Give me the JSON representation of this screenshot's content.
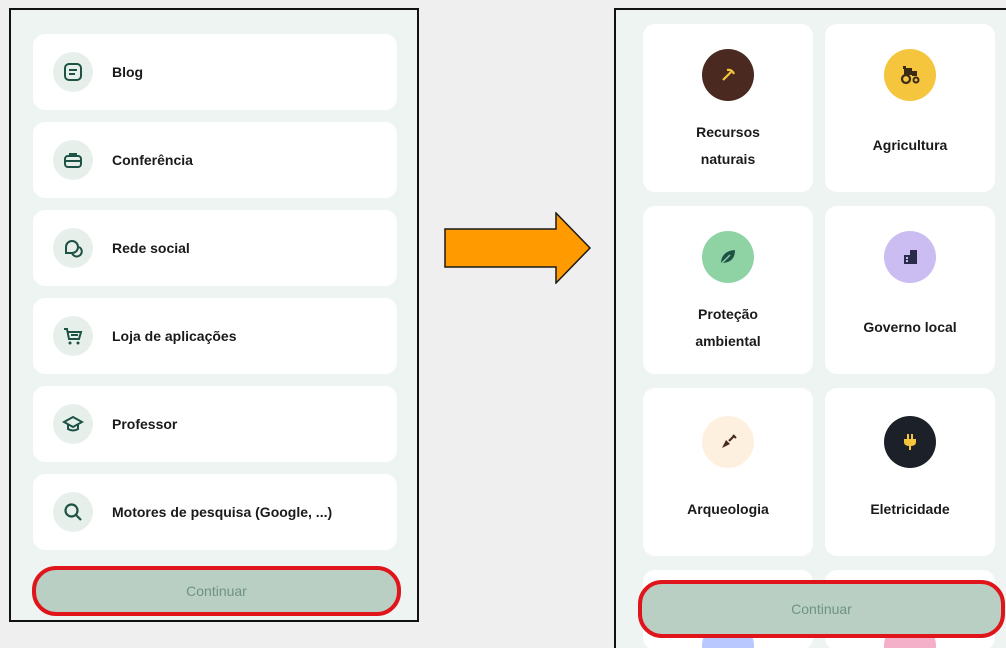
{
  "left_screen": {
    "items": [
      {
        "label": "Blog",
        "icon": "document-icon"
      },
      {
        "label": "Conferência",
        "icon": "briefcase-icon"
      },
      {
        "label": "Rede social",
        "icon": "chat-bubbles-icon"
      },
      {
        "label": "Loja de aplicações",
        "icon": "cart-icon"
      },
      {
        "label": "Professor",
        "icon": "graduation-cap-icon"
      },
      {
        "label": "Motores de pesquisa (Google, ...)",
        "icon": "magnifier-icon"
      }
    ],
    "continue_label": "Continuar"
  },
  "right_screen": {
    "cards": [
      {
        "label_line1": "Recursos",
        "label_line2": "naturais",
        "icon": "pickaxe-icon",
        "icon_bg": "#4a2a20"
      },
      {
        "label_line1": "Agricultura",
        "label_line2": "",
        "icon": "tractor-icon",
        "icon_bg": "#f4c53d"
      },
      {
        "label_line1": "Proteção",
        "label_line2": "ambiental",
        "icon": "leaf-icon",
        "icon_bg": "#8fd3a5"
      },
      {
        "label_line1": "Governo local",
        "label_line2": "",
        "icon": "buildings-icon",
        "icon_bg": "#cbbcf2"
      },
      {
        "label_line1": "Arqueologia",
        "label_line2": "",
        "icon": "shovel-icon",
        "icon_bg": "#fdf0df"
      },
      {
        "label_line1": "Eletricidade",
        "label_line2": "",
        "icon": "plug-icon",
        "icon_bg": "#1c2129"
      }
    ],
    "continue_label": "Continuar"
  },
  "colors": {
    "highlight_outline": "#e0151b",
    "arrow_fill": "#ff9a00",
    "button_bg": "#b9cfc4",
    "panel_bg": "#eef4f1"
  }
}
